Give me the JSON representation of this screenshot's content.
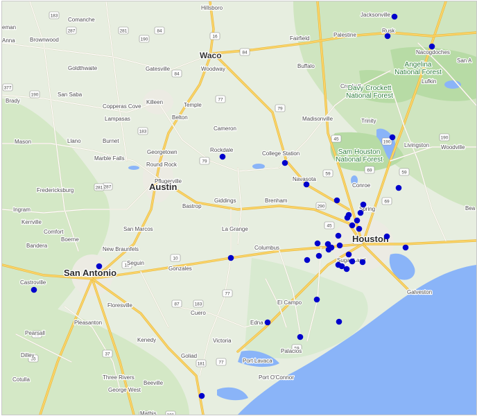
{
  "map": {
    "colors": {
      "land": "#e6ede0",
      "green": "#cfe5c0",
      "forest": "#b9dca8",
      "water": "#8ab4f8",
      "urban": "#eceae4",
      "highway": "#f7c948",
      "road": "#ffffff",
      "marker": "#0000cc"
    },
    "cities": [
      {
        "name": "Hillsboro",
        "style": "lbl"
      },
      {
        "name": "Jacksonville",
        "style": "lbl"
      },
      {
        "name": "Comanche",
        "style": "lbl"
      },
      {
        "name": "Brownwood",
        "style": "lbl"
      },
      {
        "name": "Waco",
        "style": "city"
      },
      {
        "name": "Woodway",
        "style": "lbl"
      },
      {
        "name": "Fairfield",
        "style": "lbl"
      },
      {
        "name": "Palestine",
        "style": "lbl"
      },
      {
        "name": "Rusk",
        "style": "lbl"
      },
      {
        "name": "Nacogdoches",
        "style": "lbl"
      },
      {
        "name": "Goldthwaite",
        "style": "lbl"
      },
      {
        "name": "Gatesville",
        "style": "lbl"
      },
      {
        "name": "Buffalo",
        "style": "lbl"
      },
      {
        "name": "San Saba",
        "style": "lbl"
      },
      {
        "name": "Crockett",
        "style": "lbl"
      },
      {
        "name": "Lufkin",
        "style": "lbl"
      },
      {
        "name": "Brady",
        "style": "lbl"
      },
      {
        "name": "Copperas Cove",
        "style": "lbl"
      },
      {
        "name": "Killeen",
        "style": "lbl"
      },
      {
        "name": "Temple",
        "style": "lbl"
      },
      {
        "name": "Lampasas",
        "style": "lbl"
      },
      {
        "name": "Belton",
        "style": "lbl"
      },
      {
        "name": "Madisonville",
        "style": "lbl"
      },
      {
        "name": "Trinity",
        "style": "lbl"
      },
      {
        "name": "Cameron",
        "style": "lbl"
      },
      {
        "name": "Mason",
        "style": "lbl"
      },
      {
        "name": "Llano",
        "style": "lbl"
      },
      {
        "name": "Burnet",
        "style": "lbl"
      },
      {
        "name": "Georgetown",
        "style": "lbl"
      },
      {
        "name": "Rockdale",
        "style": "lbl"
      },
      {
        "name": "College Station",
        "style": "lbl"
      },
      {
        "name": "Livingston",
        "style": "lbl"
      },
      {
        "name": "Woodville",
        "style": "lbl"
      },
      {
        "name": "Marble Falls",
        "style": "lbl"
      },
      {
        "name": "Round Rock",
        "style": "lbl"
      },
      {
        "name": "Pflugerville",
        "style": "lbl"
      },
      {
        "name": "Navasota",
        "style": "lbl"
      },
      {
        "name": "Austin",
        "style": "bigcity"
      },
      {
        "name": "Conroe",
        "style": "lbl"
      },
      {
        "name": "Fredericksburg",
        "style": "lbl"
      },
      {
        "name": "Giddings",
        "style": "lbl"
      },
      {
        "name": "Brenham",
        "style": "lbl"
      },
      {
        "name": "Bastrop",
        "style": "lbl"
      },
      {
        "name": "Spring",
        "style": "lbl"
      },
      {
        "name": "Ingram",
        "style": "lbl"
      },
      {
        "name": "Kerrville",
        "style": "lbl"
      },
      {
        "name": "La Grange",
        "style": "lbl"
      },
      {
        "name": "San Marcos",
        "style": "lbl"
      },
      {
        "name": "Comfort",
        "style": "lbl"
      },
      {
        "name": "Boerne",
        "style": "lbl"
      },
      {
        "name": "Houston",
        "style": "bigcity"
      },
      {
        "name": "Bandera",
        "style": "lbl"
      },
      {
        "name": "New Braunfels",
        "style": "lbl"
      },
      {
        "name": "Columbus",
        "style": "lbl"
      },
      {
        "name": "Seguin",
        "style": "lbl"
      },
      {
        "name": "Sugar Land",
        "style": "lbl"
      },
      {
        "name": "Gonzales",
        "style": "lbl"
      },
      {
        "name": "San Antonio",
        "style": "bigcity"
      },
      {
        "name": "Castroville",
        "style": "lbl"
      },
      {
        "name": "Galveston",
        "style": "lbl"
      },
      {
        "name": "Floresville",
        "style": "lbl"
      },
      {
        "name": "El Campo",
        "style": "lbl"
      },
      {
        "name": "Cuero",
        "style": "lbl"
      },
      {
        "name": "Pleasanton",
        "style": "lbl"
      },
      {
        "name": "Edna",
        "style": "lbl"
      },
      {
        "name": "Pearsall",
        "style": "lbl"
      },
      {
        "name": "Kenedy",
        "style": "lbl"
      },
      {
        "name": "Victoria",
        "style": "lbl"
      },
      {
        "name": "Palacios",
        "style": "lbl"
      },
      {
        "name": "Dilley",
        "style": "lbl"
      },
      {
        "name": "Goliad",
        "style": "lbl"
      },
      {
        "name": "Port Lavaca",
        "style": "lbl"
      },
      {
        "name": "Port O'Connor",
        "style": "lbl"
      },
      {
        "name": "Cotulla",
        "style": "lbl"
      },
      {
        "name": "Three Rivers",
        "style": "lbl"
      },
      {
        "name": "George West",
        "style": "lbl"
      },
      {
        "name": "Beeville",
        "style": "lbl"
      },
      {
        "name": "Mathis",
        "style": "lbl"
      },
      {
        "name": "Anna",
        "style": "lbl"
      },
      {
        "name": "eman",
        "style": "lbl"
      },
      {
        "name": "San A",
        "style": "lbl"
      },
      {
        "name": "Bea",
        "style": "lbl"
      }
    ],
    "forests": [
      {
        "name": "Angelina National Forest"
      },
      {
        "name": "Davy Crockett National Forest"
      },
      {
        "name": "Sam Houston National Forest"
      }
    ],
    "shields": [
      "183",
      "287",
      "84",
      "281",
      "377",
      "190",
      "84",
      "190",
      "79",
      "77",
      "183",
      "79",
      "45",
      "190",
      "59",
      "190",
      "287",
      "69",
      "45",
      "10",
      "35",
      "181",
      "77",
      "183",
      "87",
      "281",
      "59",
      "37",
      "59",
      "35",
      "16",
      "181",
      "181",
      "45",
      "84",
      "69",
      "290",
      "10",
      "77"
    ],
    "marker_count": 48
  }
}
